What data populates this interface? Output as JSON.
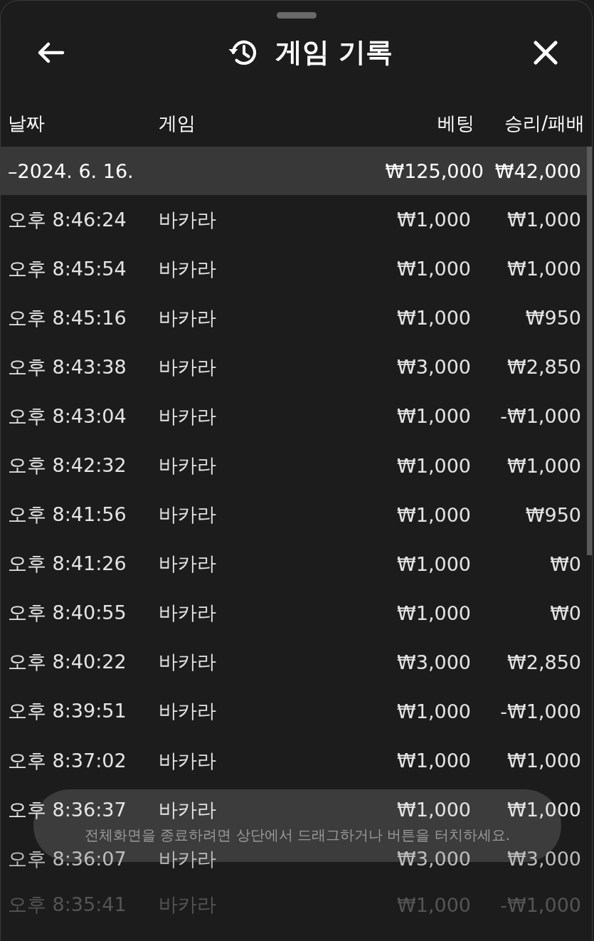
{
  "header": {
    "title": "게임 기록"
  },
  "columns": [
    "날짜",
    "게임",
    "베팅",
    "승리/패배"
  ],
  "group": {
    "date": "–2024. 6. 16.",
    "bet": "₩125,000",
    "result": "₩42,000"
  },
  "rows": [
    {
      "time": "오후 8:46:24",
      "game": "바카라",
      "bet": "₩1,000",
      "result": "₩1,000"
    },
    {
      "time": "오후 8:45:54",
      "game": "바카라",
      "bet": "₩1,000",
      "result": "₩1,000"
    },
    {
      "time": "오후 8:45:16",
      "game": "바카라",
      "bet": "₩1,000",
      "result": "₩950"
    },
    {
      "time": "오후 8:43:38",
      "game": "바카라",
      "bet": "₩3,000",
      "result": "₩2,850"
    },
    {
      "time": "오후 8:43:04",
      "game": "바카라",
      "bet": "₩1,000",
      "result": "-₩1,000"
    },
    {
      "time": "오후 8:42:32",
      "game": "바카라",
      "bet": "₩1,000",
      "result": "₩1,000"
    },
    {
      "time": "오후 8:41:56",
      "game": "바카라",
      "bet": "₩1,000",
      "result": "₩950"
    },
    {
      "time": "오후 8:41:26",
      "game": "바카라",
      "bet": "₩1,000",
      "result": "₩0"
    },
    {
      "time": "오후 8:40:55",
      "game": "바카라",
      "bet": "₩1,000",
      "result": "₩0"
    },
    {
      "time": "오후 8:40:22",
      "game": "바카라",
      "bet": "₩3,000",
      "result": "₩2,850"
    },
    {
      "time": "오후 8:39:51",
      "game": "바카라",
      "bet": "₩1,000",
      "result": "-₩1,000"
    },
    {
      "time": "오후 8:37:02",
      "game": "바카라",
      "bet": "₩1,000",
      "result": "₩1,000"
    },
    {
      "time": "오후 8:36:37",
      "game": "바카라",
      "bet": "₩1,000",
      "result": "₩1,000"
    },
    {
      "time": "오후 8:36:07",
      "game": "바카라",
      "bet": "₩3,000",
      "result": "₩3,000"
    },
    {
      "time": "오후 8:35:41",
      "game": "바카라",
      "bet": "₩1,000",
      "result": "-₩1,000"
    }
  ],
  "toast": {
    "text": "전체화면을 종료하려면 상단에서 드래그하거나 버튼을 터치하세요."
  }
}
